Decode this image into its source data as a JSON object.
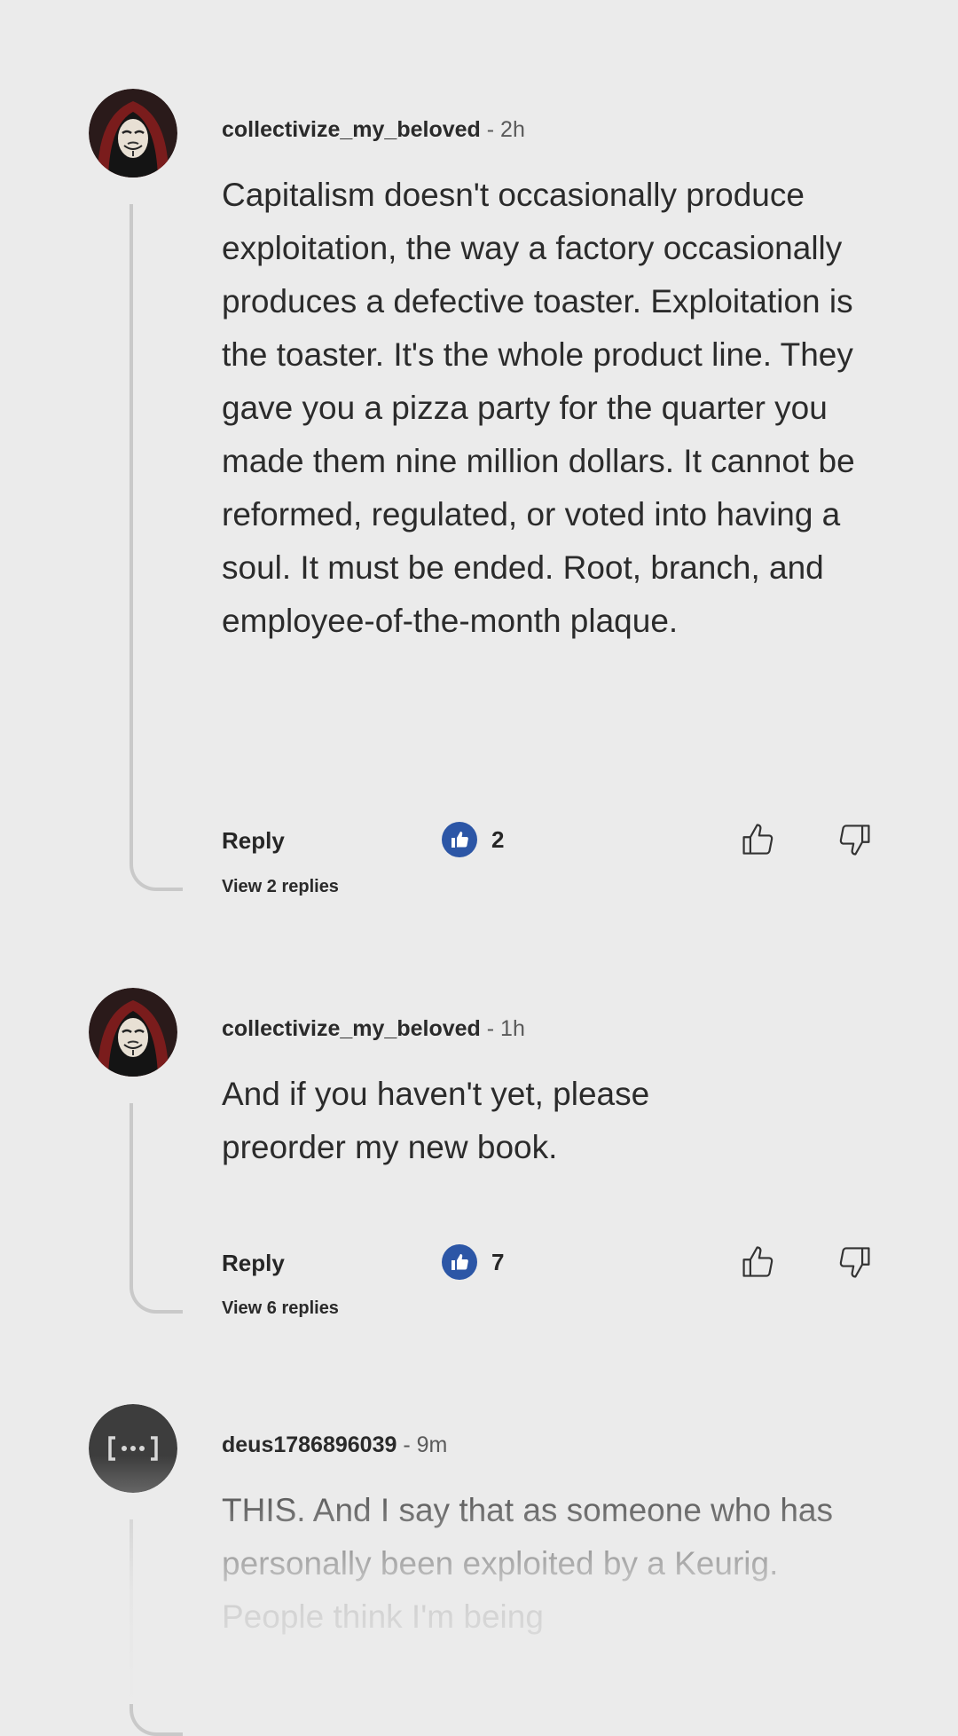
{
  "comments": [
    {
      "author": "collectivize_my_beloved",
      "separator": "-",
      "time": "2h",
      "avatar_icon": "guy-fawkes-mask-icon",
      "text": "Capitalism doesn't occasionally produce exploitation, the way a factory occasionally produces a defective toaster. Exploitation is the toaster. It's the whole product line. They gave you a pizza party for the quarter you made them nine million dollars. It cannot be reformed, regulated, or voted into having a soul. It must be ended. Root, branch, and employee-of-the-month plaque.",
      "reply_label": "Reply",
      "like_count": "2",
      "view_replies": "View 2 replies"
    },
    {
      "author": "collectivize_my_beloved",
      "separator": "-",
      "time": "1h",
      "avatar_icon": "guy-fawkes-mask-icon",
      "text": "And if you haven't yet, please preorder my new book.",
      "reply_label": "Reply",
      "like_count": "7",
      "view_replies": "View 6 replies"
    },
    {
      "author": "deus1786896039",
      "separator": "-",
      "time": "9m",
      "avatar_icon": "bracket-dots-icon",
      "text": "THIS. And I say that as someone who has personally been exploited by a Keurig. People think I'm being"
    }
  ],
  "colors": {
    "background": "#ebebeb",
    "like_badge": "#2c56a6",
    "thread_line": "#c9c9c9",
    "text": "#2b2b2b"
  }
}
